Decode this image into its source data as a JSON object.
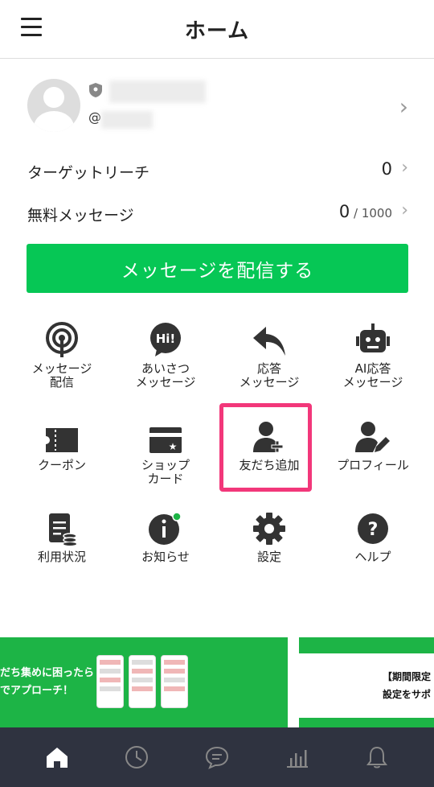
{
  "header": {
    "title": "ホーム"
  },
  "profile": {
    "at_prefix": "@"
  },
  "stats": [
    {
      "label": "ターゲットリーチ",
      "value": "0",
      "suffix": ""
    },
    {
      "label": "無料メッセージ",
      "value": "0",
      "suffix": " / 1000"
    }
  ],
  "send_button": "メッセージを配信する",
  "grid": [
    {
      "label": "メッセージ\n配信",
      "icon": "broadcast-icon"
    },
    {
      "label": "あいさつ\nメッセージ",
      "icon": "hi-bubble-icon"
    },
    {
      "label": "応答\nメッセージ",
      "icon": "reply-arrow-icon"
    },
    {
      "label": "AI応答\nメッセージ",
      "icon": "robot-icon"
    },
    {
      "label": "クーポン",
      "icon": "coupon-icon"
    },
    {
      "label": "ショップ\nカード",
      "icon": "shop-card-icon"
    },
    {
      "label": "友だち追加",
      "icon": "add-friend-icon"
    },
    {
      "label": "プロフィール",
      "icon": "profile-edit-icon"
    },
    {
      "label": "利用状況",
      "icon": "usage-icon"
    },
    {
      "label": "お知らせ",
      "icon": "info-icon"
    },
    {
      "label": "設定",
      "icon": "gear-icon"
    },
    {
      "label": "ヘルプ",
      "icon": "help-icon"
    }
  ],
  "banner": {
    "left_text_1": "だち集めに困ったら",
    "left_text_2": "でアプローチ！",
    "right_text": "【期間限定\n設定をサポ"
  },
  "tabs": [
    "home-icon",
    "clock-icon",
    "chat-icon",
    "stats-icon",
    "bell-icon"
  ],
  "colors": {
    "accent": "#06c755",
    "highlight": "#f2377a",
    "tabbar": "#2f3340",
    "notification_dot": "#1db446"
  }
}
